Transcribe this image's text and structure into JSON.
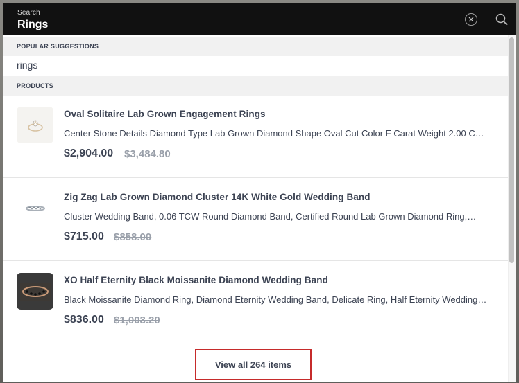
{
  "search": {
    "label": "Search",
    "value": "Rings"
  },
  "icons": {
    "clear": "close-circle-icon",
    "search": "search-icon"
  },
  "sections": {
    "suggestions_header": "POPULAR SUGGESTIONS",
    "products_header": "PRODUCTS"
  },
  "suggestions": [
    "rings"
  ],
  "products": [
    {
      "title": "Oval Solitaire Lab Grown Engagement Rings",
      "description": "Center Stone Details Diamond Type Lab Grown Diamond Shape Oval Cut Color F Carat Weight 2.00 CT…",
      "price": "$2,904.00",
      "compare_price": "$3,484.80",
      "thumb_icon": "ring-image"
    },
    {
      "title": "Zig Zag Lab Grown Diamond Cluster 14K White Gold Wedding Band",
      "description": "Cluster Wedding Band, 0.06 TCW Round Diamond Band, Certified Round Lab Grown Diamond Ring,…",
      "price": "$715.00",
      "compare_price": "$858.00",
      "thumb_icon": "band-image"
    },
    {
      "title": "XO Half Eternity Black Moissanite Diamond Wedding Band",
      "description": "Black Moissanite Diamond Ring, Diamond Eternity Wedding Band, Delicate Ring, Half Eternity Wedding…",
      "price": "$836.00",
      "compare_price": "$1,003.20",
      "thumb_icon": "black-band-image"
    }
  ],
  "footer": {
    "view_all_label": "View all 264 items"
  },
  "colors": {
    "search_bar": "#111111",
    "text": "#3c4353",
    "strike": "#9aa0aa",
    "highlight_border": "#c62b2b"
  }
}
